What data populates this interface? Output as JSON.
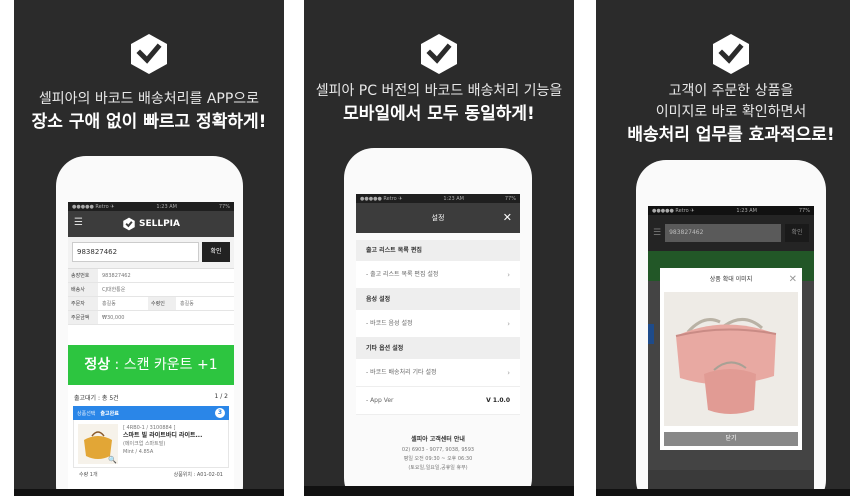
{
  "panel1": {
    "line1": "셀피아의 바코드 배송처리를 APP으로",
    "line2": "장소 구애 없이 빠르고 정확하게!",
    "status_left": "●●●●● Retro ✈",
    "status_time": "1:23 AM",
    "status_right": "77%",
    "brand": "SELLPIA",
    "barcode_value": "983827462",
    "confirm_label": "확인",
    "info": {
      "invoice_label": "송장번호",
      "invoice_value": "983827462",
      "courier_label": "배송사",
      "courier_value": "CJ대한통운",
      "orderer_label": "주문자",
      "orderer_value": "홍길동",
      "receiver_label": "수령인",
      "receiver_value": "홍길동",
      "amount_label": "주문금액",
      "amount_value": "₩30,000"
    },
    "scan_status": "정상",
    "scan_text": " : 스캔 카운트 +1",
    "list_title": "출고대기 : 총 5건",
    "list_page": "1 / 2",
    "tab_left": "상품선택",
    "tab_right": "출고완료",
    "tab_count": "3",
    "product_code": "[ 4RB0-1 / 3100884 ]",
    "product_name": "스마트 빌 라이트바디 라이트...",
    "product_opt": "(메이크업 스마트빌)",
    "product_size": "Mint / 4.85A",
    "bottom_qty": "수량 1개",
    "bottom_loc": "상품위치 : A01-02-01"
  },
  "panel2": {
    "line1": "셀피아 PC 버전의 바코드 배송처리 기능을",
    "line2": "모바일에서 모두 동일하게!",
    "status_left": "●●●●● Retro ✈",
    "status_time": "1:23 AM",
    "status_right": "77%",
    "settings_title": "설정",
    "close_icon": "✕",
    "sections": [
      {
        "header": "출고 리스트 목록 편집",
        "item": "- 출고 리스트 목록 편집 설정"
      },
      {
        "header": "음성 설정",
        "item": "- 바코드 음성 설정"
      },
      {
        "header": "기타 옵션 설정",
        "item": "- 바코드 배송처리 기타 설정"
      }
    ],
    "app_ver_label": "- App Ver",
    "app_ver_value": "V 1.0.0",
    "center_title": "셀피아 고객센터 안내",
    "center_phone": "02) 6903 - 9077, 9038, 9593",
    "center_hours": "평일 오전 09:30 ~ 오후 06:30",
    "center_note": "(토요일,일요일,공휴일 휴무)"
  },
  "panel3": {
    "line1": "고객이 주문한 상품을",
    "line2": "이미지로 바로 확인하면서",
    "line3": "배송처리 업무를 효과적으로!",
    "status_left": "●●●●● Retro ✈",
    "status_time": "1:23 AM",
    "status_right": "77%",
    "barcode_value": "983827462",
    "confirm_label": "확인",
    "modal_title": "상품 확대 이미지",
    "modal_close": "✕",
    "modal_button": "닫기"
  },
  "colors": {
    "panel_bg": "#2b2b2b",
    "brand_bar": "#3c3c3c",
    "scan_green": "#2dc540",
    "tab_blue": "#2a86e8",
    "bag_pink": "#e8a9a2"
  }
}
